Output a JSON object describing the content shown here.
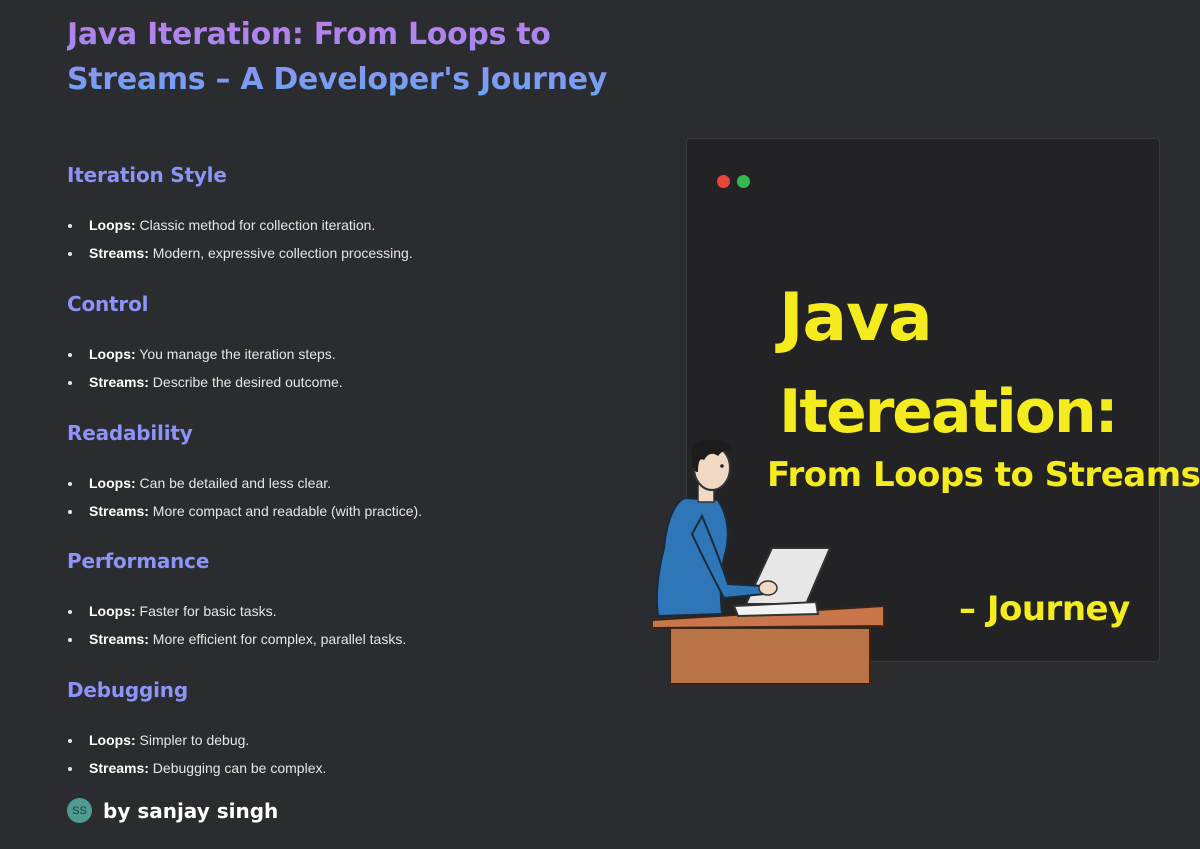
{
  "article": {
    "title": "Java Iteration: From Loops to Streams – A Developer's Journey"
  },
  "sections": [
    {
      "heading": "Iteration Style",
      "items": [
        {
          "label": "Loops:",
          "text": " Classic method for collection iteration."
        },
        {
          "label": "Streams:",
          "text": " Modern, expressive collection processing."
        }
      ]
    },
    {
      "heading": "Control",
      "items": [
        {
          "label": "Loops:",
          "text": " You manage the iteration steps."
        },
        {
          "label": "Streams:",
          "text": " Describe the desired outcome."
        }
      ]
    },
    {
      "heading": "Readability",
      "items": [
        {
          "label": "Loops:",
          "text": " Can be detailed and less clear."
        },
        {
          "label": "Streams:",
          "text": " More compact and readable (with practice)."
        }
      ]
    },
    {
      "heading": "Performance",
      "items": [
        {
          "label": "Loops:",
          "text": " Faster for basic tasks."
        },
        {
          "label": "Streams:",
          "text": " More efficient for complex, parallel tasks."
        }
      ]
    },
    {
      "heading": "Debugging",
      "items": [
        {
          "label": "Loops:",
          "text": " Simpler to debug."
        },
        {
          "label": "Streams:",
          "text": " Debugging can be complex."
        }
      ]
    }
  ],
  "author": {
    "initials": "SS",
    "byline": "by sanjay singh"
  },
  "hero": {
    "line1": "Java",
    "line2": "Itereation:",
    "line3": "From Loops to Streams",
    "line4": "– Journey"
  },
  "colors": {
    "background": "#2b2c30",
    "accent_purple": "#c57be6",
    "accent_blue": "#62a8f4",
    "hero_text": "#f5ec1f"
  }
}
